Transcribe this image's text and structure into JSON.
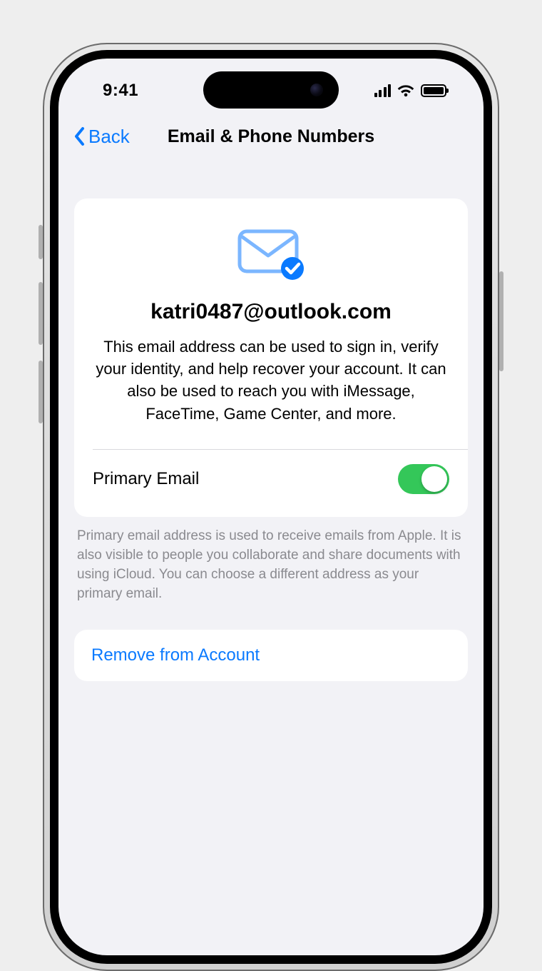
{
  "status": {
    "time": "9:41"
  },
  "nav": {
    "back_label": "Back",
    "title": "Email & Phone Numbers"
  },
  "card": {
    "email": "katri0487@outlook.com",
    "description": "This email address can be used to sign in, verify your identity, and help recover your account. It can also be used to reach you with iMessage, FaceTime, Game Center, and more.",
    "primary_label": "Primary Email",
    "primary_on": true
  },
  "footer_note": "Primary email address is used to receive emails from Apple. It is also visible to people you collaborate and share documents with using iCloud. You can choose a different address as your primary email.",
  "remove_label": "Remove from Account",
  "colors": {
    "accent_blue": "#0a7aff",
    "switch_green": "#34c759"
  },
  "icons": {
    "mail": "mail-verified-icon",
    "chevron_left": "chevron-left-icon",
    "cellular": "cellular-icon",
    "wifi": "wifi-icon",
    "battery": "battery-icon"
  }
}
